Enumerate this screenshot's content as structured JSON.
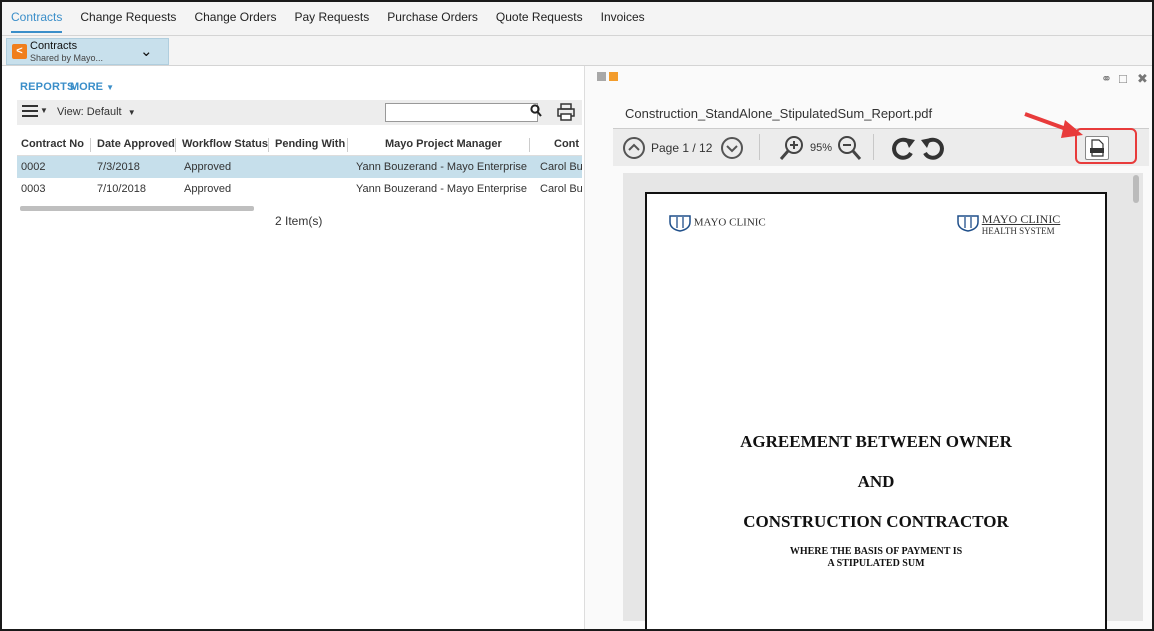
{
  "tabs": [
    "Contracts",
    "Change Requests",
    "Change Orders",
    "Pay Requests",
    "Purchase Orders",
    "Quote Requests",
    "Invoices"
  ],
  "active_tab_index": 0,
  "context": {
    "title": "Contracts",
    "subtitle": "Shared by Mayo..."
  },
  "left": {
    "reports_label": "REPORTS",
    "more_label": "MORE",
    "view_label": "View: Default",
    "search_placeholder": "",
    "columns": [
      "Contract No",
      "Date Approved",
      "Workflow Status",
      "Pending With",
      "Mayo Project Manager",
      "Cont"
    ],
    "rows": [
      {
        "contract_no": "0002",
        "date": "7/3/2018",
        "status": "Approved",
        "pending": "",
        "manager": "Yann Bouzerand - Mayo Enterprise",
        "cont": "Carol Bu"
      },
      {
        "contract_no": "0003",
        "date": "7/10/2018",
        "status": "Approved",
        "pending": "",
        "manager": "Yann Bouzerand - Mayo Enterprise",
        "cont": "Carol Bu"
      }
    ],
    "item_count": "2 Item(s)"
  },
  "right": {
    "file_name": "Construction_StandAlone_StipulatedSum_Report.pdf",
    "page_text": "Page 1 / 12",
    "zoom": "95%",
    "pdf_button_label": "PDF",
    "logo_left": "MAYO CLINIC",
    "logo_right_line1": "MAYO CLINIC",
    "logo_right_line2": "HEALTH SYSTEM",
    "doc_line1": "AGREEMENT BETWEEN OWNER",
    "doc_line2": "AND",
    "doc_line3": "CONSTRUCTION CONTRACTOR",
    "doc_line4": "WHERE THE BASIS OF PAYMENT IS",
    "doc_line5": "A STIPULATED SUM"
  },
  "colors": {
    "accent": "#3a8ec9",
    "brand_orange": "#f39c2b",
    "selection": "#c6dfeb",
    "highlight": "#e83b3b"
  }
}
